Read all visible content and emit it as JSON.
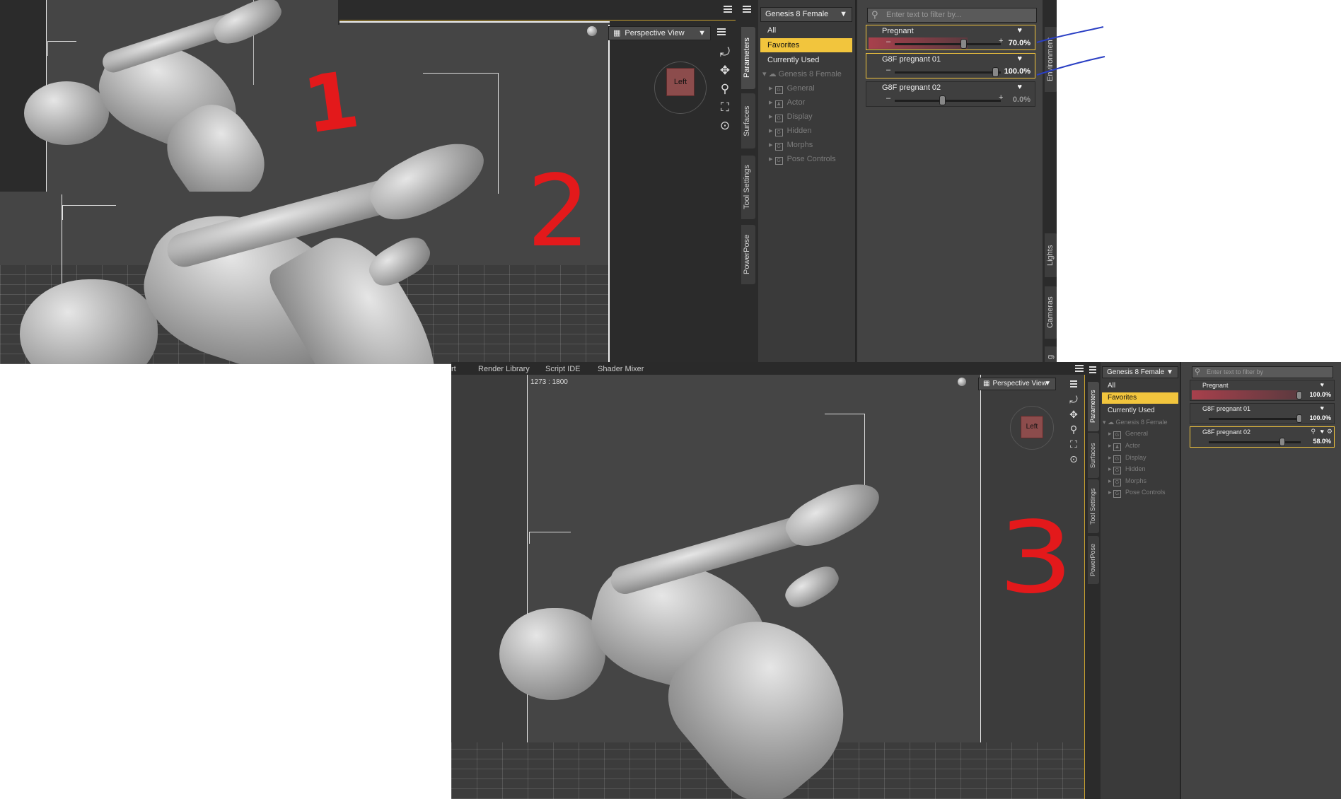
{
  "annotations": {
    "num1": "1",
    "num2": "2",
    "num3": "3"
  },
  "shot_top": {
    "viewport_dropdown": "Perspective View",
    "cube_label": "Left",
    "figure_dropdown": "Genesis 8 Female",
    "filter_placeholder": "Enter text to filter by...",
    "vertical_tabs": [
      "Parameters",
      "Surfaces",
      "Tool Settings",
      "PowerPose"
    ],
    "right_tabs": [
      "Environment",
      "Lights",
      "Cameras",
      "g"
    ],
    "categories": [
      "All",
      "Favorites",
      "Currently Used"
    ],
    "tree_root": "Genesis 8 Female",
    "tree_items": [
      "General",
      "Actor",
      "Display",
      "Hidden",
      "Morphs",
      "Pose Controls"
    ],
    "params": [
      {
        "name": "Pregnant",
        "value": "70.0%",
        "fraction": 0.7
      },
      {
        "name": "G8F pregnant 01",
        "value": "100.0%",
        "fraction": 1.0
      },
      {
        "name": "G8F pregnant 02",
        "value": "0.0%",
        "fraction": 0.0
      }
    ]
  },
  "shot_bottom": {
    "tabs": [
      "rt",
      "Render Library",
      "Script IDE",
      "Shader Mixer"
    ],
    "aspect_label": "1273 : 1800",
    "viewport_dropdown": "Perspective View",
    "cube_label": "Left",
    "figure_dropdown": "Genesis 8 Female",
    "filter_placeholder": "Enter text to filter by",
    "vertical_tabs": [
      "Parameters",
      "Surfaces",
      "Tool Settings",
      "PowerPose"
    ],
    "categories": [
      "All",
      "Favorites",
      "Currently Used"
    ],
    "tree_root": "Genesis 8 Female",
    "tree_items": [
      "General",
      "Actor",
      "Display",
      "Hidden",
      "Morphs",
      "Pose Controls"
    ],
    "params": [
      {
        "name": "Pregnant",
        "value": "100.0%",
        "fraction": 1.0
      },
      {
        "name": "G8F pregnant 01",
        "value": "100.0%",
        "fraction": 1.0
      },
      {
        "name": "G8F pregnant 02",
        "value": "58.0%",
        "fraction": 0.58
      }
    ]
  },
  "colors": {
    "accent": "#f2c53d",
    "pen_red": "#e3191b",
    "pen_blue": "#2a3fc4"
  }
}
